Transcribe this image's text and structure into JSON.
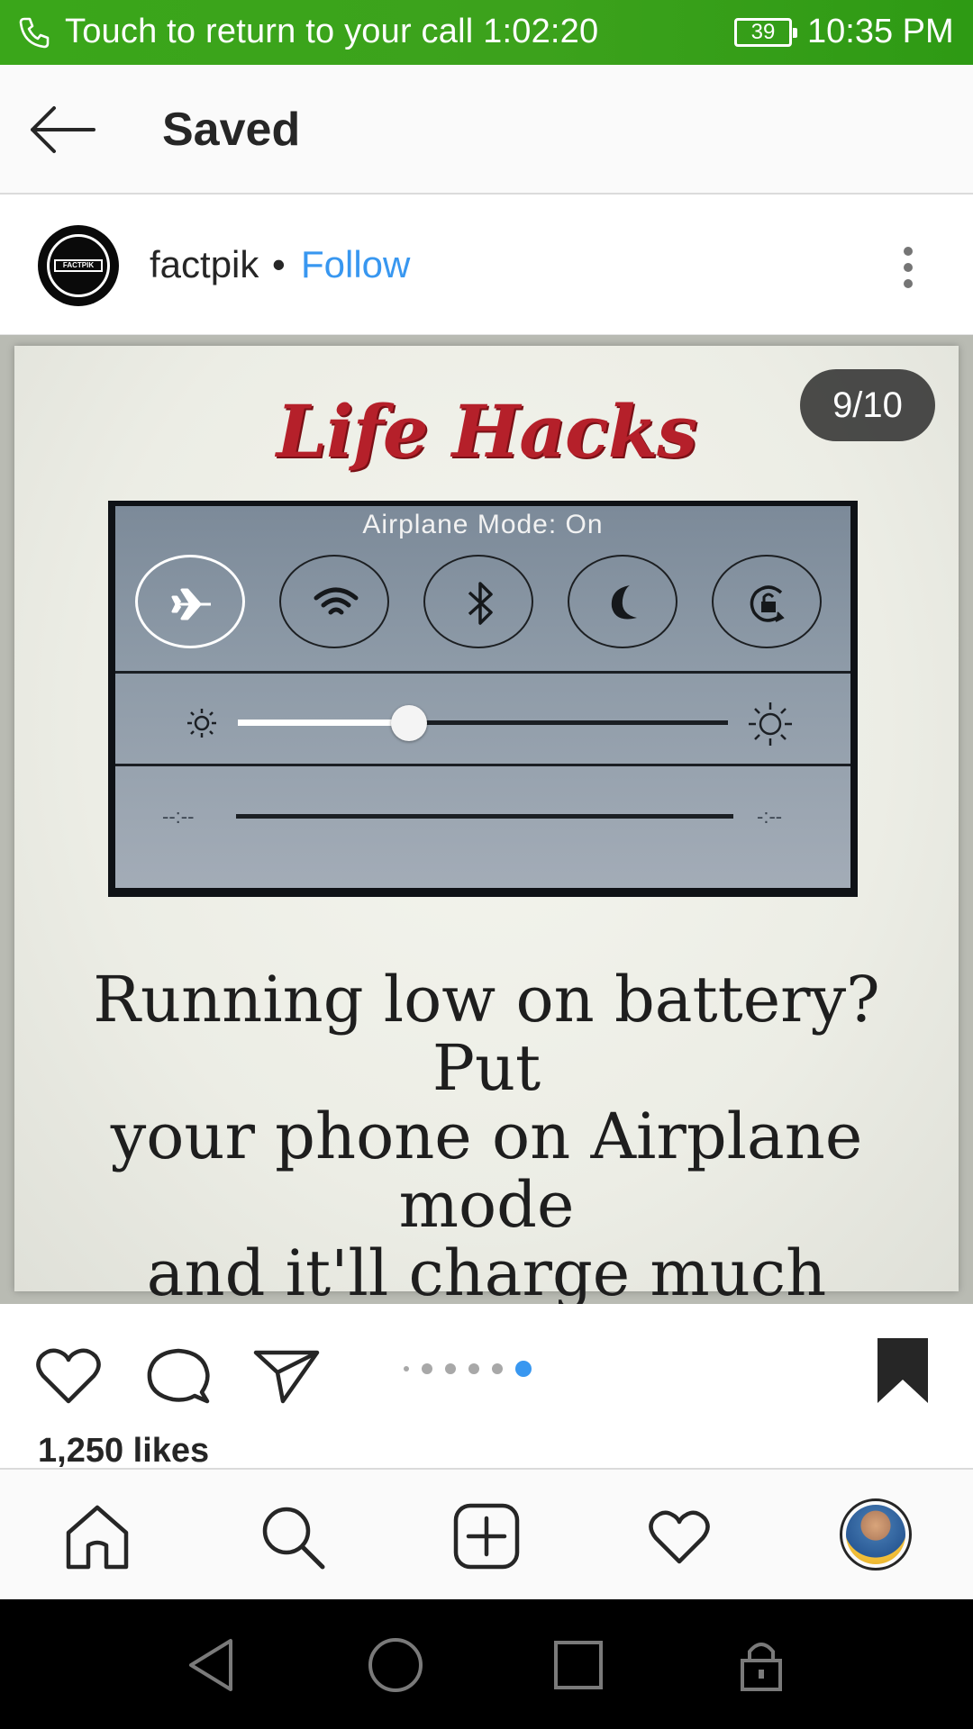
{
  "status_bar": {
    "call_text": "Touch to return to your call",
    "call_timer": "1:02:20",
    "battery": "39",
    "time": "10:35 PM"
  },
  "header": {
    "title": "Saved"
  },
  "post": {
    "username": "factpik",
    "separator": "•",
    "follow_label": "Follow",
    "avatar_logo_text": "FACTPIK",
    "carousel_counter": "9/10",
    "image": {
      "headline": "Life Hacks",
      "control_center_label": "Airplane Mode: On",
      "time_left": "--:--",
      "time_right": "-:--",
      "brightness_level": 0.35,
      "caption_lines": [
        "Running low on battery? Put",
        "your phone on Airplane mode",
        "and it'll charge much faster!"
      ]
    },
    "likes": "1,250 likes",
    "carousel_dots": {
      "count": 6,
      "active_index": 5,
      "active_color": "#3897f0"
    }
  },
  "icons": {
    "status": [
      "phone-icon"
    ],
    "toggles": [
      "airplane-icon",
      "wifi-icon",
      "bluetooth-icon",
      "moon-icon",
      "rotation-lock-icon"
    ],
    "actions": [
      "heart-icon",
      "comment-icon",
      "share-icon",
      "bookmark-icon"
    ],
    "bottom_nav": [
      "home-icon",
      "search-icon",
      "add-post-icon",
      "activity-heart-icon",
      "profile-avatar"
    ],
    "system_nav": [
      "back-triangle-icon",
      "home-circle-icon",
      "recents-square-icon",
      "lock-icon"
    ]
  },
  "colors": {
    "status_bar": "#3aa61a",
    "link_blue": "#3897f0",
    "headline_red": "#b5202a"
  }
}
